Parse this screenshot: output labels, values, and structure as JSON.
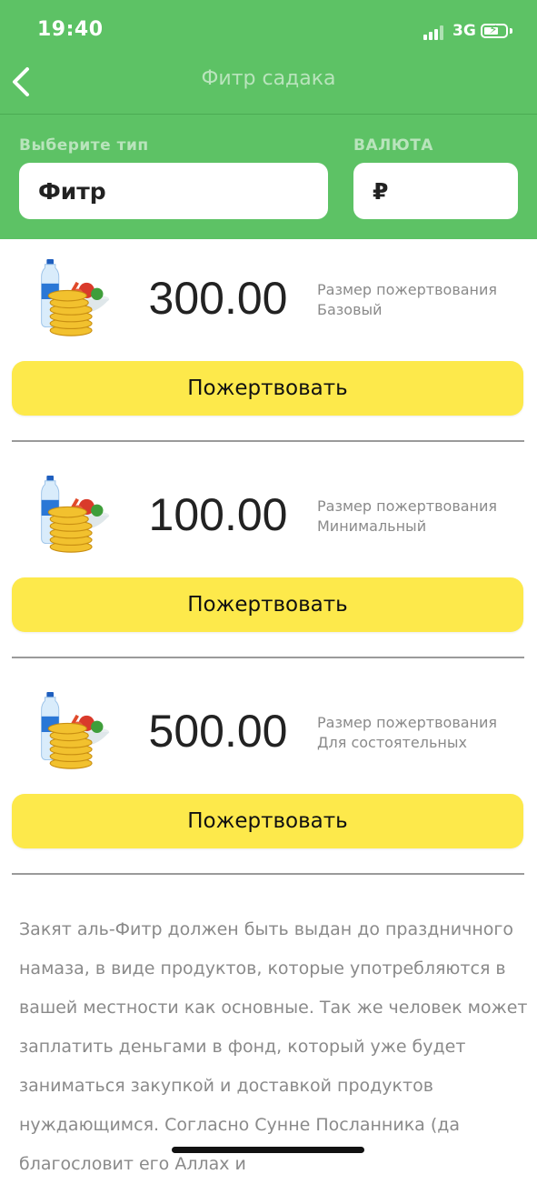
{
  "status_bar": {
    "time": "19:40",
    "network": "3G"
  },
  "nav": {
    "title": "Фитр садака"
  },
  "type_field": {
    "label": "Выберите тип",
    "value": "Фитр"
  },
  "currency_field": {
    "label": "ВАЛЮТА",
    "value": "₽"
  },
  "donations": [
    {
      "amount": "300.00",
      "label_line1": "Размер пожертвования",
      "label_line2": "Базовый",
      "button": "Пожертвовать"
    },
    {
      "amount": "100.00",
      "label_line1": "Размер пожертвования",
      "label_line2": "Минимальный",
      "button": "Пожертвовать"
    },
    {
      "amount": "500.00",
      "label_line1": "Размер пожертвования",
      "label_line2": "Для состоятельных",
      "button": "Пожертвовать"
    }
  ],
  "description": "Закят аль-Фитр должен быть выдан до праздничного намаза, в виде продуктов, которые употребляются в вашей местности как основные. Так же человек может заплатить деньгами в фонд, который уже будет заниматься закупкой и доставкой продуктов нуждающимся. Согласно Сунне Посланника (да благословит его Аллах и",
  "colors": {
    "header": "#5dc265",
    "button": "#fde94b"
  }
}
